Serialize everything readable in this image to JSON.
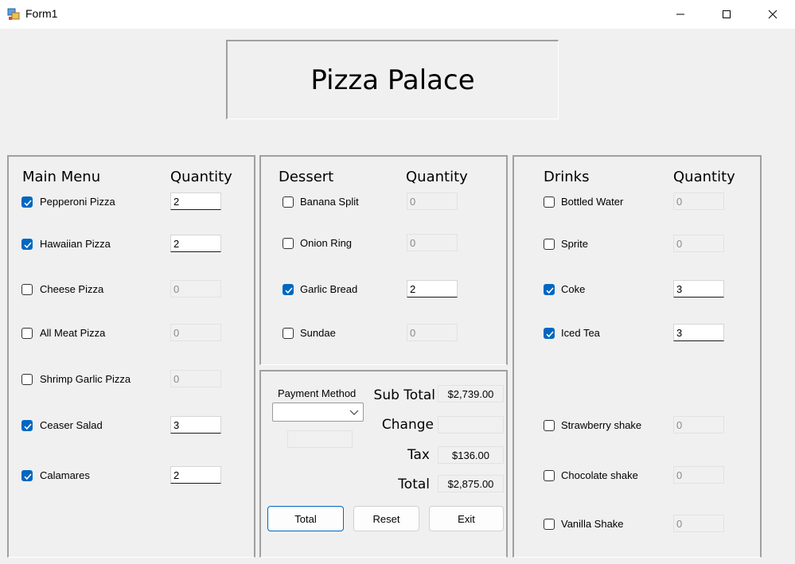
{
  "window": {
    "title": "Form1"
  },
  "header": {
    "title": "Pizza Palace"
  },
  "main_menu": {
    "heading": "Main Menu",
    "qty_heading": "Quantity",
    "items": [
      {
        "label": "Pepperoni Pizza",
        "checked": true,
        "qty": "2"
      },
      {
        "label": "Hawaiian Pizza",
        "checked": true,
        "qty": "2"
      },
      {
        "label": "Cheese Pizza",
        "checked": false,
        "qty": "0"
      },
      {
        "label": "All Meat Pizza",
        "checked": false,
        "qty": "0"
      },
      {
        "label": "Shrimp Garlic Pizza",
        "checked": false,
        "qty": "0"
      },
      {
        "label": "Ceaser Salad",
        "checked": true,
        "qty": "3"
      },
      {
        "label": "Calamares",
        "checked": true,
        "qty": "2"
      }
    ]
  },
  "dessert": {
    "heading": "Dessert",
    "qty_heading": "Quantity",
    "items": [
      {
        "label": "Banana Split",
        "checked": false,
        "qty": "0"
      },
      {
        "label": "Onion Ring",
        "checked": false,
        "qty": "0"
      },
      {
        "label": "Garlic Bread",
        "checked": true,
        "qty": "2"
      },
      {
        "label": "Sundae",
        "checked": false,
        "qty": "0"
      }
    ]
  },
  "drinks": {
    "heading": "Drinks",
    "qty_heading": "Quantity",
    "items": [
      {
        "label": "Bottled Water",
        "checked": false,
        "qty": "0"
      },
      {
        "label": "Sprite",
        "checked": false,
        "qty": "0"
      },
      {
        "label": "Coke",
        "checked": true,
        "qty": "3"
      },
      {
        "label": "Iced Tea",
        "checked": true,
        "qty": "3"
      },
      {
        "label": "Strawberry shake",
        "checked": false,
        "qty": "0"
      },
      {
        "label": "Chocolate shake",
        "checked": false,
        "qty": "0"
      },
      {
        "label": "Vanilla Shake",
        "checked": false,
        "qty": "0"
      }
    ]
  },
  "payment": {
    "method_label": "Payment Method",
    "method_value": "",
    "subtotal_label": "Sub Total",
    "subtotal_value": "$2,739.00",
    "change_label": "Change",
    "change_value": "",
    "tax_label": "Tax",
    "tax_value": "$136.00",
    "total_label": "Total",
    "total_value": "$2,875.00"
  },
  "buttons": {
    "total": "Total",
    "reset": "Reset",
    "exit": "Exit"
  },
  "colors": {
    "accent": "#0067c0",
    "background": "#f0f0f0"
  }
}
